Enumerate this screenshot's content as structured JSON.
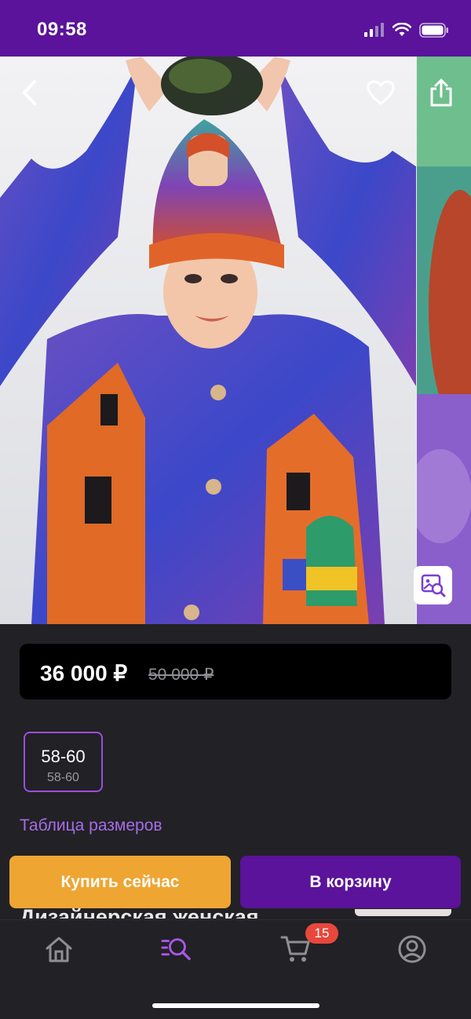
{
  "status_bar": {
    "time": "09:58"
  },
  "product": {
    "price_current": "36 000 ₽",
    "price_old": "50 000 ₽",
    "title_peek": "Дизайнерская женская"
  },
  "sizes": [
    {
      "label": "58-60",
      "sub": "58-60",
      "selected": true
    }
  ],
  "links": {
    "size_table": "Таблица размеров"
  },
  "actions": {
    "buy_now": "Купить сейчас",
    "add_to_cart": "В корзину"
  },
  "tab_bar": {
    "items": [
      {
        "name": "home",
        "icon": "home-icon"
      },
      {
        "name": "catalog-search",
        "icon": "search-list-icon",
        "active": true
      },
      {
        "name": "cart",
        "icon": "cart-icon",
        "badge": "15"
      },
      {
        "name": "profile",
        "icon": "profile-icon"
      }
    ]
  },
  "colors": {
    "brand_purple": "#5a139a",
    "accent_orange": "#efa532",
    "link_purple": "#a76ce8",
    "badge_red": "#e8473c"
  }
}
